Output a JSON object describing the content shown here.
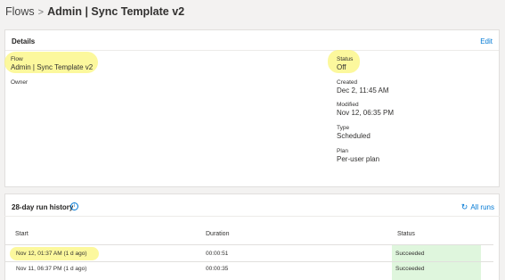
{
  "breadcrumb": {
    "root": "Flows",
    "separator": ">",
    "current": "Admin | Sync Template v2"
  },
  "details": {
    "title": "Details",
    "edit_label": "Edit",
    "flow_label": "Flow",
    "flow_value": "Admin | Sync Template v2",
    "owner_label": "Owner",
    "status_label": "Status",
    "status_value": "Off",
    "created_label": "Created",
    "created_value": "Dec 2, 11:45 AM",
    "modified_label": "Modified",
    "modified_value": "Nov 12, 06:35 PM",
    "type_label": "Type",
    "type_value": "Scheduled",
    "plan_label": "Plan",
    "plan_value": "Per-user plan"
  },
  "history": {
    "title": "28-day run history",
    "all_runs_label": "All runs",
    "columns": {
      "start": "Start",
      "duration": "Duration",
      "status": "Status"
    },
    "rows": [
      {
        "start": "Nov 12, 01:37 AM (1 d ago)",
        "duration": "00:00:51",
        "status": "Succeeded"
      },
      {
        "start": "Nov 11, 06:37 PM (1 d ago)",
        "duration": "00:00:35",
        "status": "Succeeded"
      }
    ]
  },
  "colors": {
    "accent": "#0078d4",
    "highlight": "#fbf67c",
    "success_bg": "#dff6dd"
  }
}
